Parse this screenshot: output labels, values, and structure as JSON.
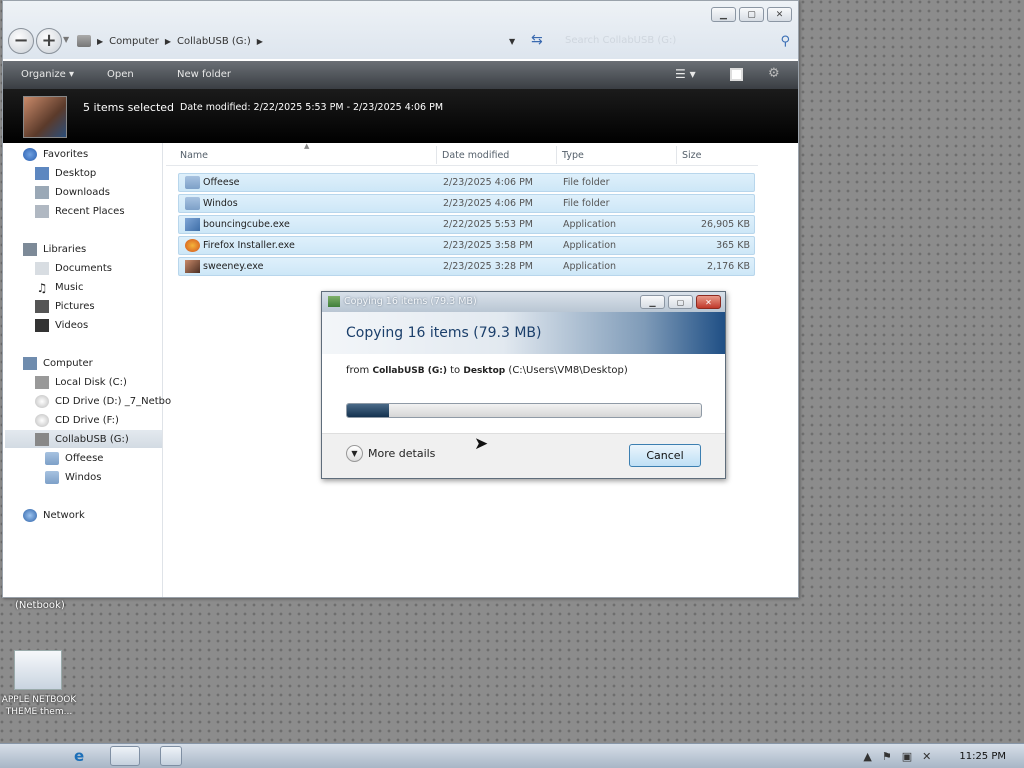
{
  "explorer": {
    "address": [
      "Computer",
      "CollabUSB (G:)"
    ],
    "search_placeholder": "Search CollabUSB (G:)",
    "toolbar": {
      "organize": "Organize",
      "open": "Open",
      "new_folder": "New folder"
    },
    "details": {
      "selected": "5 items selected",
      "date_modified": "Date modified: 2/22/2025 5:53 PM - 2/23/2025 4:06 PM"
    },
    "nav": {
      "favorites": "Favorites",
      "desktop": "Desktop",
      "downloads": "Downloads",
      "recent": "Recent Places",
      "libraries": "Libraries",
      "documents": "Documents",
      "music": "Music",
      "pictures": "Pictures",
      "videos": "Videos",
      "computer": "Computer",
      "local_disk": "Local Disk (C:)",
      "cd_d": "CD Drive (D:) _7_Netbo",
      "cd_f": "CD Drive (F:)",
      "collab": "CollabUSB (G:)",
      "offeese": "Offeese",
      "windos": "Windos",
      "network": "Network"
    },
    "columns": {
      "name": "Name",
      "date": "Date modified",
      "type": "Type",
      "size": "Size"
    },
    "files": [
      {
        "name": "Offeese",
        "date": "2/23/2025 4:06 PM",
        "type": "File folder",
        "size": ""
      },
      {
        "name": "Windos",
        "date": "2/23/2025 4:06 PM",
        "type": "File folder",
        "size": ""
      },
      {
        "name": "bouncingcube.exe",
        "date": "2/22/2025 5:53 PM",
        "type": "Application",
        "size": "26,905 KB"
      },
      {
        "name": "Firefox Installer.exe",
        "date": "2/23/2025 3:58 PM",
        "type": "Application",
        "size": "365 KB"
      },
      {
        "name": "sweeney.exe",
        "date": "2/23/2025 3:28 PM",
        "type": "Application",
        "size": "2,176 KB"
      }
    ]
  },
  "copy_dialog": {
    "title": "Copying 16 items (79.3 MB)",
    "heading": "Copying 16 items (79.3 MB)",
    "from_prefix": "from",
    "source": "CollabUSB (G:)",
    "to_word": "to",
    "dest": "Desktop",
    "dest_path": "(C:\\Users\\VM8\\Desktop)",
    "progress": 0.12,
    "more_details": "More details",
    "cancel": "Cancel"
  },
  "desktop": {
    "netbook_label": "(Netbook)",
    "icon_label_1": "APPLE NETBOOK",
    "icon_label_2": "THEME them..."
  },
  "taskbar": {
    "clock": "11:25 PM"
  },
  "colors": {
    "toolbar": "#3a3e43",
    "selection": "#cde7f7",
    "dialog_accent": "#1f4f85",
    "cancel_border": "#3c7fb1"
  }
}
